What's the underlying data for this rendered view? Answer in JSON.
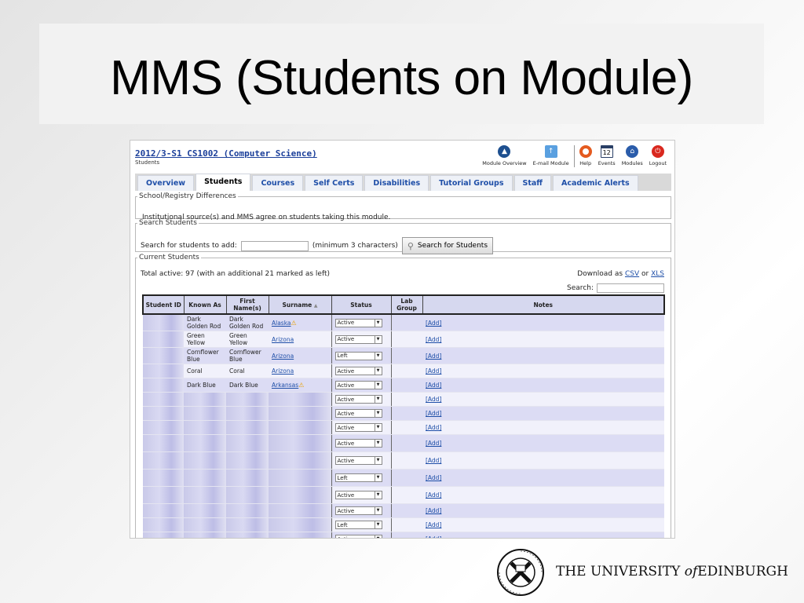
{
  "slide": {
    "title": "MMS (Students on Module)"
  },
  "module": {
    "title": "2012/3-S1 CS1002 (Computer Science)",
    "subtitle": "Students"
  },
  "toolbar": [
    {
      "label": "Module Overview",
      "icon": "module-overview-icon",
      "color": "#1d4f8f"
    },
    {
      "label": "E-mail Module",
      "icon": "email-module-icon",
      "color": "#5aa0e0"
    },
    {
      "label": "Help",
      "icon": "help-lifebuoy-icon",
      "color": "#e45a1f"
    },
    {
      "label": "Events",
      "icon": "calendar-icon",
      "color": "#2a3f66",
      "badge": "12"
    },
    {
      "label": "Modules",
      "icon": "home-icon",
      "color": "#2a5caa"
    },
    {
      "label": "Logout",
      "icon": "power-icon",
      "color": "#d9281e"
    }
  ],
  "tabs": [
    "Overview",
    "Students",
    "Courses",
    "Self Certs",
    "Disabilities",
    "Tutorial Groups",
    "Staff",
    "Academic Alerts"
  ],
  "registry": {
    "legend": "School/Registry Differences",
    "text": "Institutional source(s) and MMS agree on students taking this module."
  },
  "search_students": {
    "legend": "Search Students",
    "label": "Search for students to add:",
    "hint": "(minimum 3 characters)",
    "button": "Search for Students"
  },
  "current": {
    "legend": "Current Students",
    "total": "Total active: 97 (with an additional 21 marked as left)",
    "download_prefix": "Download as",
    "csv": "CSV",
    "or": "or",
    "xls": "XLS",
    "search_label": "Search:"
  },
  "table": {
    "headers": [
      "Student ID",
      "Known As",
      "First Name(s)",
      "Surname",
      "Status",
      "Lab Group",
      "Notes"
    ],
    "add_label": "[Add]",
    "rows": [
      {
        "known": "Dark Golden Rod",
        "first": "Dark Golden Rod",
        "surname": "Alaska",
        "warn": true,
        "status": "Active"
      },
      {
        "known": "Green Yellow",
        "first": "Green Yellow",
        "surname": "Arizona",
        "warn": false,
        "status": "Active"
      },
      {
        "known": "Cornflower Blue",
        "first": "Cornflower Blue",
        "surname": "Arizona",
        "warn": false,
        "status": "Left"
      },
      {
        "known": "Coral",
        "first": "Coral",
        "surname": "Arizona",
        "warn": false,
        "status": "Active"
      },
      {
        "known": "Dark Blue",
        "first": "Dark Blue",
        "surname": "Arkansas",
        "warn": true,
        "status": "Active"
      },
      {
        "known": "",
        "first": "",
        "surname": "",
        "warn": false,
        "status": "Active"
      },
      {
        "known": "",
        "first": "",
        "surname": "",
        "warn": false,
        "status": "Active"
      },
      {
        "known": "",
        "first": "",
        "surname": "",
        "warn": false,
        "status": "Active"
      },
      {
        "known": "",
        "first": "",
        "surname": "",
        "warn": false,
        "status": "Active"
      },
      {
        "known": "",
        "first": "",
        "surname": "",
        "warn": false,
        "status": "Active"
      },
      {
        "known": "",
        "first": "",
        "surname": "",
        "warn": false,
        "status": "Left"
      },
      {
        "known": "",
        "first": "",
        "surname": "",
        "warn": false,
        "status": "Active"
      },
      {
        "known": "",
        "first": "",
        "surname": "",
        "warn": false,
        "status": "Active"
      },
      {
        "known": "",
        "first": "",
        "surname": "",
        "warn": false,
        "status": "Left"
      },
      {
        "known": "",
        "first": "",
        "surname": "",
        "warn": false,
        "status": "Active"
      }
    ]
  },
  "footer": {
    "university_pre": "THE UNIVERSITY",
    "university_of": "of",
    "university_post": "EDINBURGH",
    "logo_icon": "university-crest-icon"
  }
}
